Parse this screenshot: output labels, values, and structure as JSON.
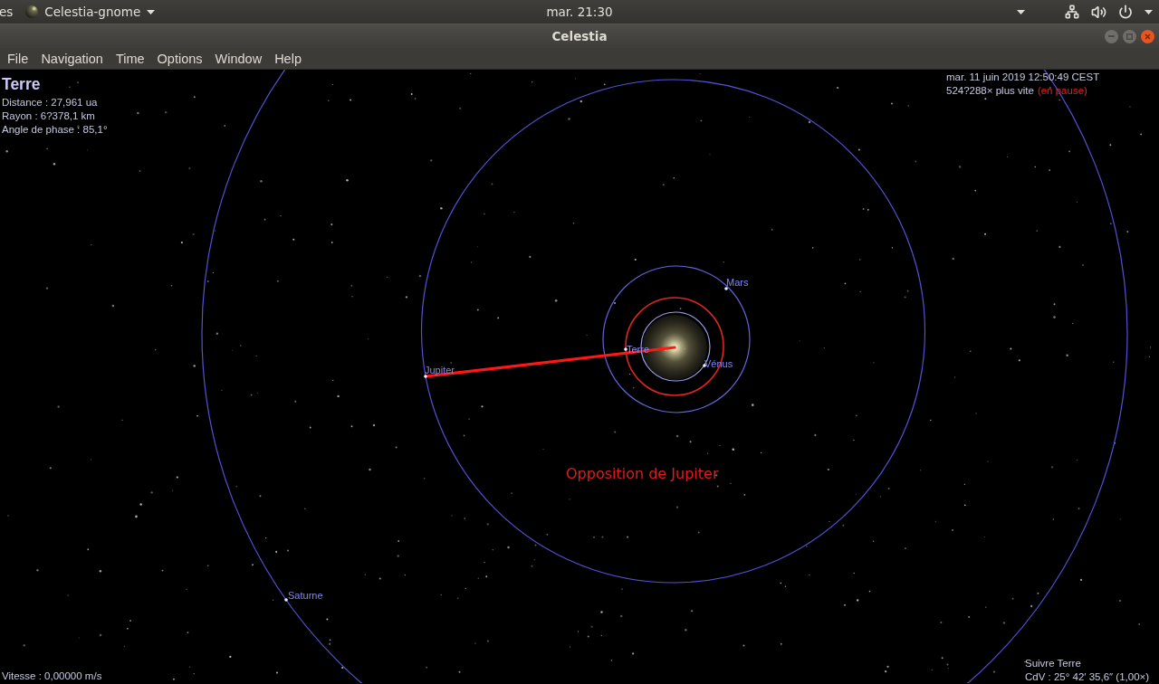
{
  "top_panel": {
    "activities": "es",
    "app_name": "Celestia-gnome",
    "clock": "mar. 21:30"
  },
  "window": {
    "title": "Celestia"
  },
  "menu": [
    "File",
    "Navigation",
    "Time",
    "Options",
    "Window",
    "Help"
  ],
  "selection": {
    "name": "Terre",
    "details": [
      "Distance : 27,961 ua",
      "Rayon : 6?378,1 km",
      "Angle de phase : 85,1°"
    ]
  },
  "time": {
    "date": "mar. 11 juin 2019 12:50:49 CEST",
    "rate": "524?288× plus vite",
    "status": "(en pause)"
  },
  "orbits": [
    {
      "label": "Vénus",
      "selected": false
    },
    {
      "label": "Terre",
      "selected": true
    },
    {
      "label": "Mars",
      "selected": false
    },
    {
      "label": "Jupiter",
      "selected": false
    },
    {
      "label": "Saturne",
      "selected": false
    }
  ],
  "event": "Opposition de Jupiter",
  "speed": "Vitesse : 0,00000 m/s",
  "camera": {
    "tracking": "Suivre Terre",
    "field_of_view": "CdV : 25° 42′ 35,6″ (1,00×)"
  }
}
